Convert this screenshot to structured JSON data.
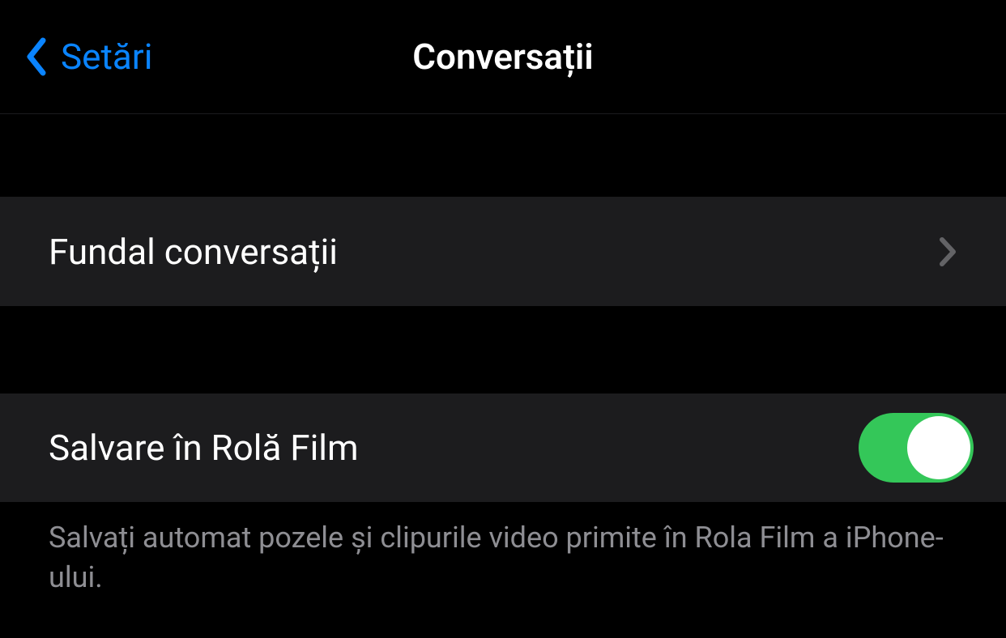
{
  "nav": {
    "back_label": "Setări",
    "title": "Conversații"
  },
  "rows": {
    "background": {
      "label": "Fundal conversații"
    },
    "save_camera_roll": {
      "label": "Salvare în Rolă Film",
      "enabled": true
    }
  },
  "footer": {
    "text": "Salvați automat pozele și clipurile video primite în Rola Film a iPhone-ului."
  }
}
